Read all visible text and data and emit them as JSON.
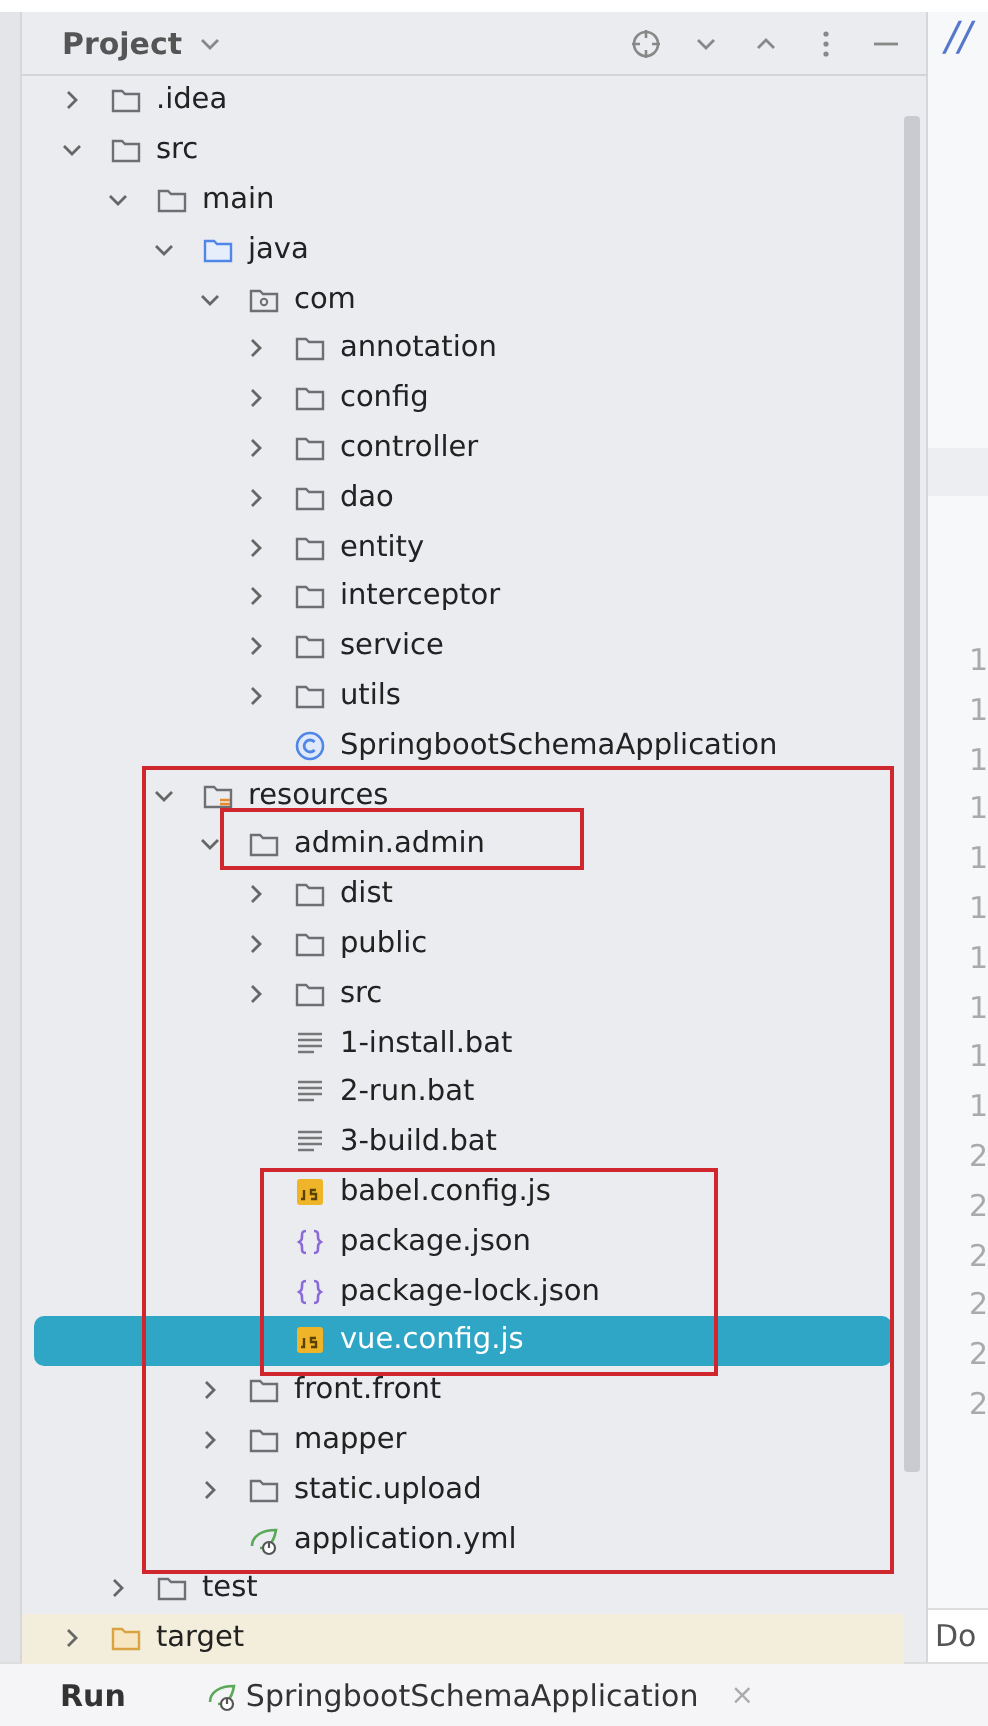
{
  "panel": {
    "title": "Project"
  },
  "tree": [
    {
      "name": ".idea",
      "kind": "folder",
      "expanded": false,
      "selected": false
    },
    {
      "name": "src",
      "kind": "folder",
      "expanded": true,
      "selected": false,
      "children": [
        {
          "name": "main",
          "kind": "folder",
          "expanded": true,
          "selected": false,
          "children": [
            {
              "name": "java",
              "kind": "source_root",
              "expanded": true,
              "selected": false,
              "children": [
                {
                  "name": "com",
                  "kind": "package",
                  "expanded": true,
                  "selected": false,
                  "children": [
                    {
                      "name": "annotation",
                      "kind": "folder",
                      "expanded": false,
                      "selected": false
                    },
                    {
                      "name": "config",
                      "kind": "folder",
                      "expanded": false,
                      "selected": false
                    },
                    {
                      "name": "controller",
                      "kind": "folder",
                      "expanded": false,
                      "selected": false
                    },
                    {
                      "name": "dao",
                      "kind": "folder",
                      "expanded": false,
                      "selected": false
                    },
                    {
                      "name": "entity",
                      "kind": "folder",
                      "expanded": false,
                      "selected": false
                    },
                    {
                      "name": "interceptor",
                      "kind": "folder",
                      "expanded": false,
                      "selected": false
                    },
                    {
                      "name": "service",
                      "kind": "folder",
                      "expanded": false,
                      "selected": false
                    },
                    {
                      "name": "utils",
                      "kind": "folder",
                      "expanded": false,
                      "selected": false
                    },
                    {
                      "name": "SpringbootSchemaApplication",
                      "kind": "java_class",
                      "selected": false
                    }
                  ]
                }
              ]
            },
            {
              "name": "resources",
              "kind": "resources_root",
              "expanded": true,
              "selected": false,
              "children": [
                {
                  "name": "admin.admin",
                  "kind": "folder",
                  "expanded": true,
                  "selected": false,
                  "children": [
                    {
                      "name": "dist",
                      "kind": "folder",
                      "expanded": false,
                      "selected": false
                    },
                    {
                      "name": "public",
                      "kind": "folder",
                      "expanded": false,
                      "selected": false
                    },
                    {
                      "name": "src",
                      "kind": "folder",
                      "expanded": false,
                      "selected": false
                    },
                    {
                      "name": "1-install.bat",
                      "kind": "text",
                      "selected": false
                    },
                    {
                      "name": "2-run.bat",
                      "kind": "text",
                      "selected": false
                    },
                    {
                      "name": "3-build.bat",
                      "kind": "text",
                      "selected": false
                    },
                    {
                      "name": "babel.config.js",
                      "kind": "js",
                      "selected": false
                    },
                    {
                      "name": "package.json",
                      "kind": "json",
                      "selected": false
                    },
                    {
                      "name": "package-lock.json",
                      "kind": "json",
                      "selected": false
                    },
                    {
                      "name": "vue.config.js",
                      "kind": "js",
                      "selected": true
                    }
                  ]
                },
                {
                  "name": "front.front",
                  "kind": "folder",
                  "expanded": false,
                  "selected": false
                },
                {
                  "name": "mapper",
                  "kind": "folder",
                  "expanded": false,
                  "selected": false
                },
                {
                  "name": "static.upload",
                  "kind": "folder",
                  "expanded": false,
                  "selected": false
                },
                {
                  "name": "application.yml",
                  "kind": "spring",
                  "selected": false
                }
              ]
            }
          ]
        },
        {
          "name": "test",
          "kind": "folder",
          "expanded": false,
          "selected": false
        }
      ]
    },
    {
      "name": "target",
      "kind": "excluded",
      "expanded": false,
      "selected": false
    }
  ],
  "editor": {
    "header_text": "//",
    "line_numbers": [
      "1",
      "1",
      "1",
      "1",
      "1",
      "1",
      "1",
      "1",
      "1",
      "1",
      "2",
      "2",
      "2",
      "2",
      "2",
      "2"
    ],
    "footer_text": "Do"
  },
  "run_bar": {
    "label": "Run",
    "tabs": [
      {
        "name": "SpringbootSchemaApplication",
        "selected": true,
        "close_glyph": "×"
      }
    ]
  }
}
